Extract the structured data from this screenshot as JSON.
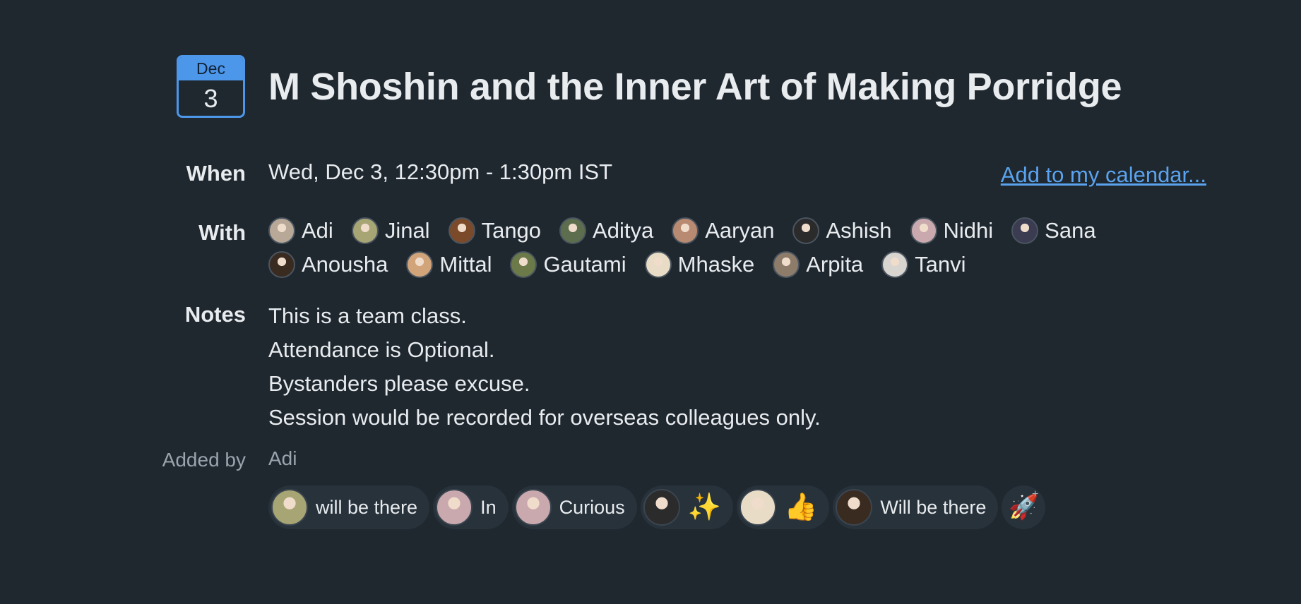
{
  "event": {
    "month": "Dec",
    "day": "3",
    "title": "M Shoshin and the Inner Art of Making Porridge"
  },
  "labels": {
    "when": "When",
    "with": "With",
    "notes": "Notes",
    "added_by": "Added by"
  },
  "when": {
    "text": "Wed, Dec 3, 12:30pm - 1:30pm IST",
    "add_calendar_link": "Add to my calendar..."
  },
  "attendees": [
    {
      "name": "Adi",
      "color": "#b8a898"
    },
    {
      "name": "Jinal",
      "color": "#a7a574"
    },
    {
      "name": "Tango",
      "color": "#7a4a2a"
    },
    {
      "name": "Aditya",
      "color": "#5c6e4e"
    },
    {
      "name": "Aaryan",
      "color": "#b98a72"
    },
    {
      "name": "Ashish",
      "color": "#2b2b2b"
    },
    {
      "name": "Nidhi",
      "color": "#c9a9ad"
    },
    {
      "name": "Sana",
      "color": "#3b3b52"
    },
    {
      "name": "Anousha",
      "color": "#3a2b20"
    },
    {
      "name": "Mittal",
      "color": "#d2a47a"
    },
    {
      "name": "Gautami",
      "color": "#6b7a48"
    },
    {
      "name": "Mhaske",
      "color": "#e8dcc6"
    },
    {
      "name": "Arpita",
      "color": "#8e7c6a"
    },
    {
      "name": "Tanvi",
      "color": "#d8d4d0"
    }
  ],
  "notes": [
    "This is a team class.",
    "Attendance is Optional.",
    "Bystanders please excuse.",
    "Session would be recorded for overseas colleagues only."
  ],
  "added_by": "Adi",
  "reactions": [
    {
      "text": "will be there",
      "emoji": false,
      "color": "#a7a574"
    },
    {
      "text": "In",
      "emoji": false,
      "color": "#c9a9ad"
    },
    {
      "text": "Curious",
      "emoji": false,
      "color": "#c9a9ad"
    },
    {
      "text": "✨",
      "emoji": true,
      "color": "#2b2b2b"
    },
    {
      "text": "👍",
      "emoji": true,
      "color": "#e8dcc6"
    },
    {
      "text": "Will be there",
      "emoji": false,
      "color": "#3a2b20"
    }
  ],
  "add_reaction_icon": "🚀",
  "colors": {
    "background": "#1f272f",
    "accent": "#4d97ea",
    "link": "#5aa3ee"
  }
}
